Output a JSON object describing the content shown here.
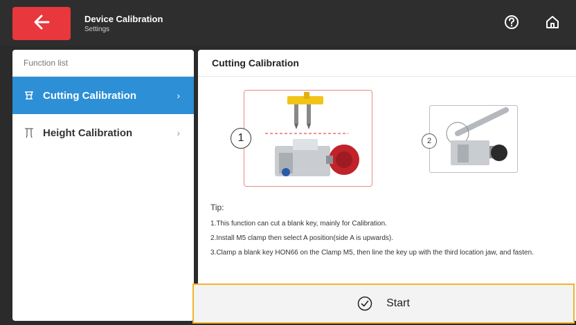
{
  "header": {
    "title": "Device Calibration",
    "subtitle": "Settings"
  },
  "sidebar": {
    "header": "Function list",
    "items": [
      {
        "label": "Cutting Calibration",
        "icon": "cutter-icon",
        "active": true
      },
      {
        "label": "Height Calibration",
        "icon": "height-icon",
        "active": false
      }
    ]
  },
  "main": {
    "title": "Cutting Calibration",
    "diagram": {
      "step1": "1",
      "step2": "2"
    },
    "tip_label": "Tip:",
    "tips": [
      "1.This function can cut a blank key, mainly for Calibration.",
      "2.Install M5 clamp then select A position(side A is upwards).",
      "3.Clamp a blank key HON66 on the Clamp M5, then line the key up with the third location jaw, and fasten."
    ]
  },
  "start_button": {
    "label": "Start"
  },
  "colors": {
    "accent_red": "#e8373d",
    "active_blue": "#2d8fd6",
    "highlight_yellow": "#f0b429"
  }
}
